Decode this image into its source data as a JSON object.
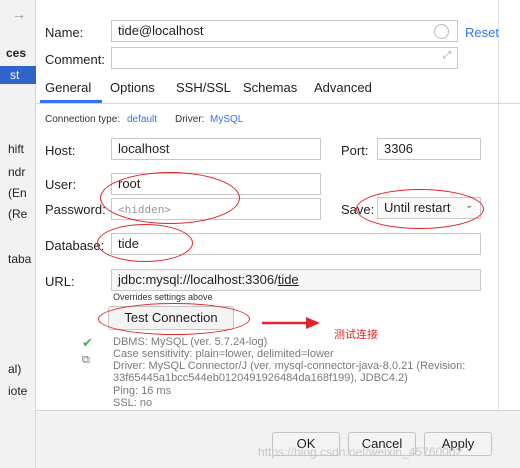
{
  "sidebar": {
    "arrow": "→",
    "items": [
      {
        "label": "ces"
      },
      {
        "label": "st"
      },
      {
        "label": "hift"
      },
      {
        "label": "ndr"
      },
      {
        "label": "(En"
      },
      {
        "label": "(Re"
      },
      {
        "label": "taba"
      },
      {
        "label": "al)"
      },
      {
        "label": "iote"
      }
    ]
  },
  "header": {
    "name_label": "Name:",
    "name_value": "tide@localhost",
    "reset_label": "Reset",
    "comment_label": "Comment:"
  },
  "tabs": [
    {
      "label": "General",
      "active": true
    },
    {
      "label": "Options"
    },
    {
      "label": "SSH/SSL"
    },
    {
      "label": "Schemas"
    },
    {
      "label": "Advanced"
    }
  ],
  "connection": {
    "type_label": "Connection type:",
    "type_value": "default",
    "driver_label": "Driver:",
    "driver_value": "MySQL"
  },
  "form": {
    "host_label": "Host:",
    "host_value": "localhost",
    "port_label": "Port:",
    "port_value": "3306",
    "user_label": "User:",
    "user_value": "root",
    "password_label": "Password:",
    "password_placeholder": "<hidden>",
    "save_label": "Save:",
    "save_value": "Until restart",
    "database_label": "Database:",
    "database_value": "tide",
    "url_label": "URL:",
    "url_prefix": "jdbc:mysql://localhost:3306/",
    "url_db": "tide",
    "url_note": "Overrides settings above"
  },
  "test": {
    "button_label": "Test Connection",
    "annotation": "测试连接",
    "info_lines": [
      "DBMS: MySQL (ver. 5.7.24-log)",
      "Case sensitivity: plain=lower, delimited=lower",
      "Driver: MySQL Connector/J (ver. mysql-connector-java-8.0.21 (Revision:",
      "33f65445a1bcc544eb0120491926484da168f199), JDBC4.2)",
      "Ping: 16 ms",
      "SSL: no"
    ]
  },
  "footer": {
    "ok_label": "OK",
    "cancel_label": "Cancel",
    "apply_label": "Apply",
    "watermark": "https://blog.csdn.net/weixin_45760002"
  },
  "colors": {
    "accent": "#3574f0",
    "annotation_red": "#e3242b",
    "success_green": "#4caf50"
  }
}
